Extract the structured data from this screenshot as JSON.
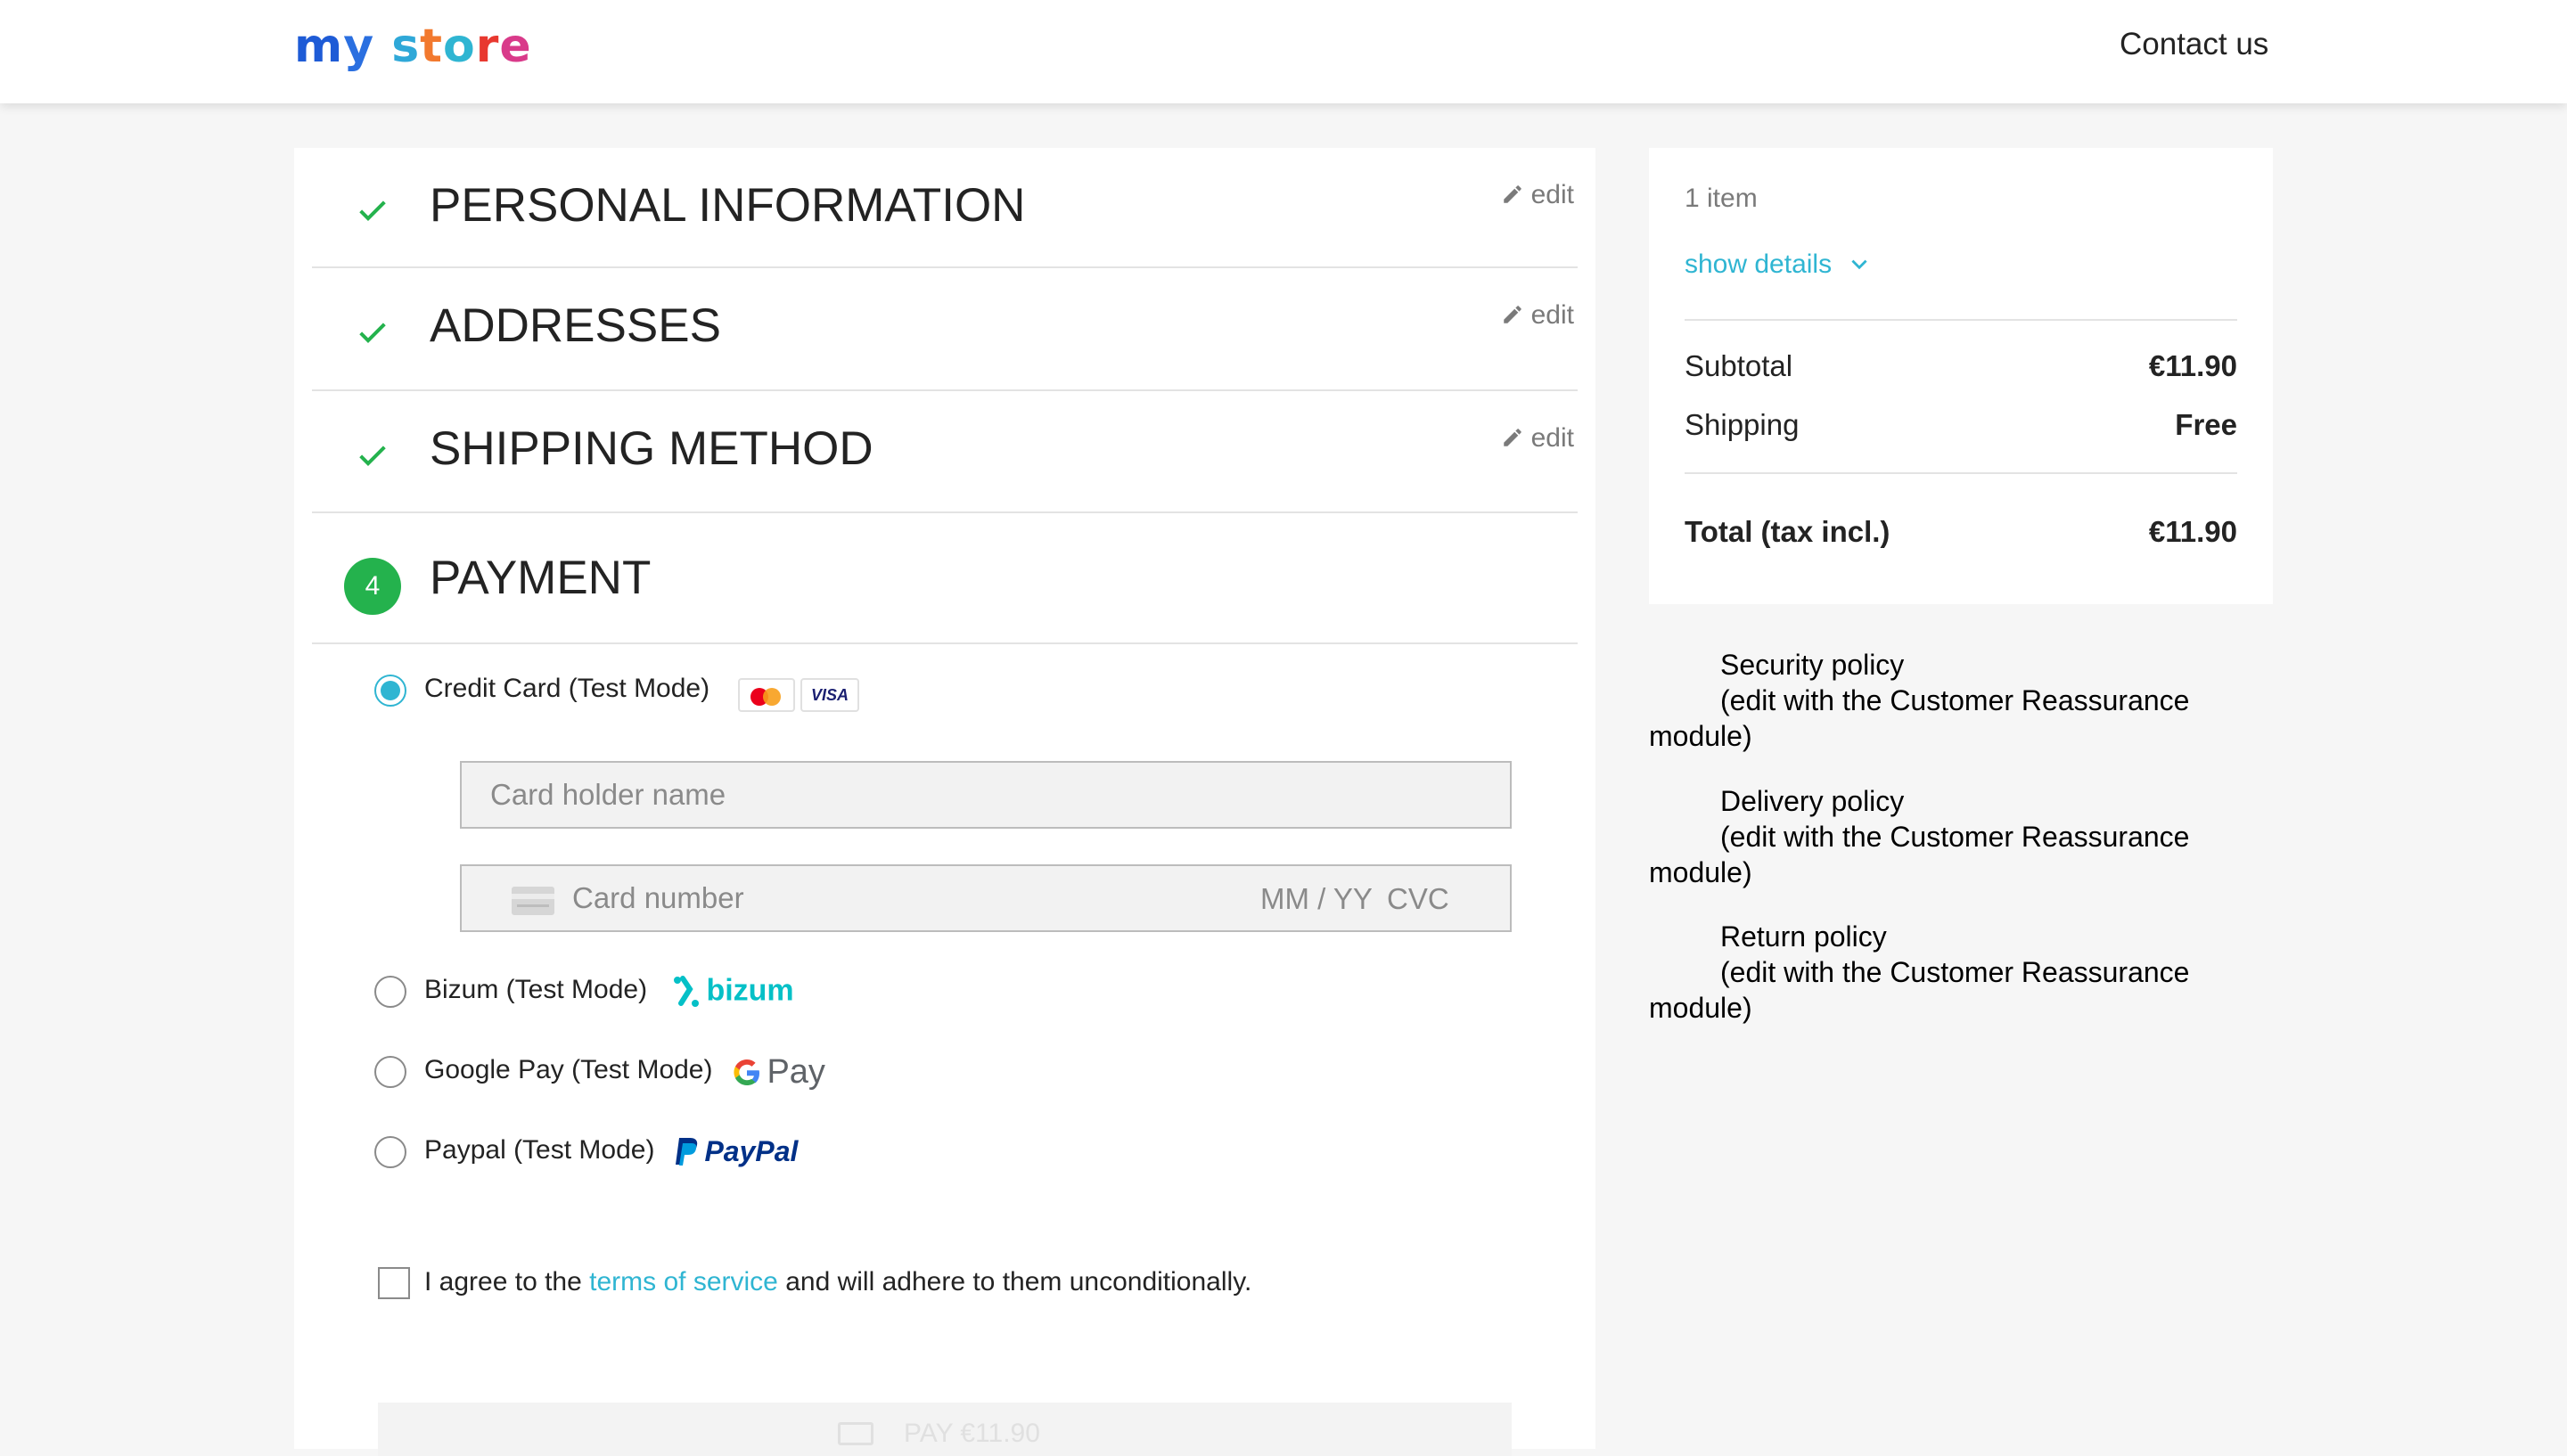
{
  "header": {
    "logo_letters": [
      {
        "ch": "m",
        "color": "#1e5bd6"
      },
      {
        "ch": "y",
        "color": "#2a6fe0"
      },
      {
        "ch": " ",
        "color": "#000000"
      },
      {
        "ch": "s",
        "color": "#2fa8d8"
      },
      {
        "ch": "t",
        "color": "#f2792e"
      },
      {
        "ch": "o",
        "color": "#2fb5d2"
      },
      {
        "ch": "r",
        "color": "#e8382f"
      },
      {
        "ch": "e",
        "color": "#d93a8a"
      }
    ],
    "contact_label": "Contact us"
  },
  "steps": [
    {
      "title": "PERSONAL INFORMATION",
      "edit": "edit",
      "status": "done",
      "icon": "check-icon"
    },
    {
      "title": "ADDRESSES",
      "edit": "edit",
      "status": "done",
      "icon": "check-icon"
    },
    {
      "title": "SHIPPING METHOD",
      "edit": "edit",
      "status": "done",
      "icon": "check-icon"
    },
    {
      "title": "PAYMENT",
      "number": "4",
      "status": "current"
    }
  ],
  "payment": {
    "options": [
      {
        "label": "Credit Card (Test Mode)",
        "selected": true,
        "icons": [
          "mastercard-icon",
          "visa-icon"
        ]
      },
      {
        "label": "Bizum (Test Mode)",
        "selected": false,
        "brand": "bizum"
      },
      {
        "label": "Google Pay (Test Mode)",
        "selected": false,
        "brand": "Pay"
      },
      {
        "label": "Paypal (Test Mode)",
        "selected": false,
        "brand": "PayPal"
      }
    ],
    "visa_text": "VISA",
    "card_holder_placeholder": "Card holder name",
    "card_number_placeholder": "Card number",
    "expiry_placeholder": "MM / YY",
    "cvc_placeholder": "CVC",
    "terms": {
      "prefix": "I agree to the",
      "link": "terms of service",
      "suffix": "and will adhere to them unconditionally.",
      "checked": false
    },
    "pay_button": "PAY €11.90"
  },
  "summary": {
    "items_count": "1 item",
    "show_details": "show details",
    "subtotal_label": "Subtotal",
    "subtotal_value": "€11.90",
    "shipping_label": "Shipping",
    "shipping_value": "Free",
    "total_label": "Total (tax incl.)",
    "total_value": "€11.90"
  },
  "reassurance": [
    {
      "title": "Security policy",
      "line2": "(edit with the Customer Reassurance",
      "line3": "module)"
    },
    {
      "title": "Delivery policy",
      "line2": "(edit with the Customer Reassurance",
      "line3": "module)"
    },
    {
      "title": "Return policy",
      "line2": "(edit with the Customer Reassurance",
      "line3": "module)"
    }
  ],
  "colors": {
    "accent": "#2fb5d2",
    "success": "#24b24d",
    "bizum": "#05c0c7",
    "paypal_dark": "#003087",
    "paypal_light": "#009cde"
  }
}
